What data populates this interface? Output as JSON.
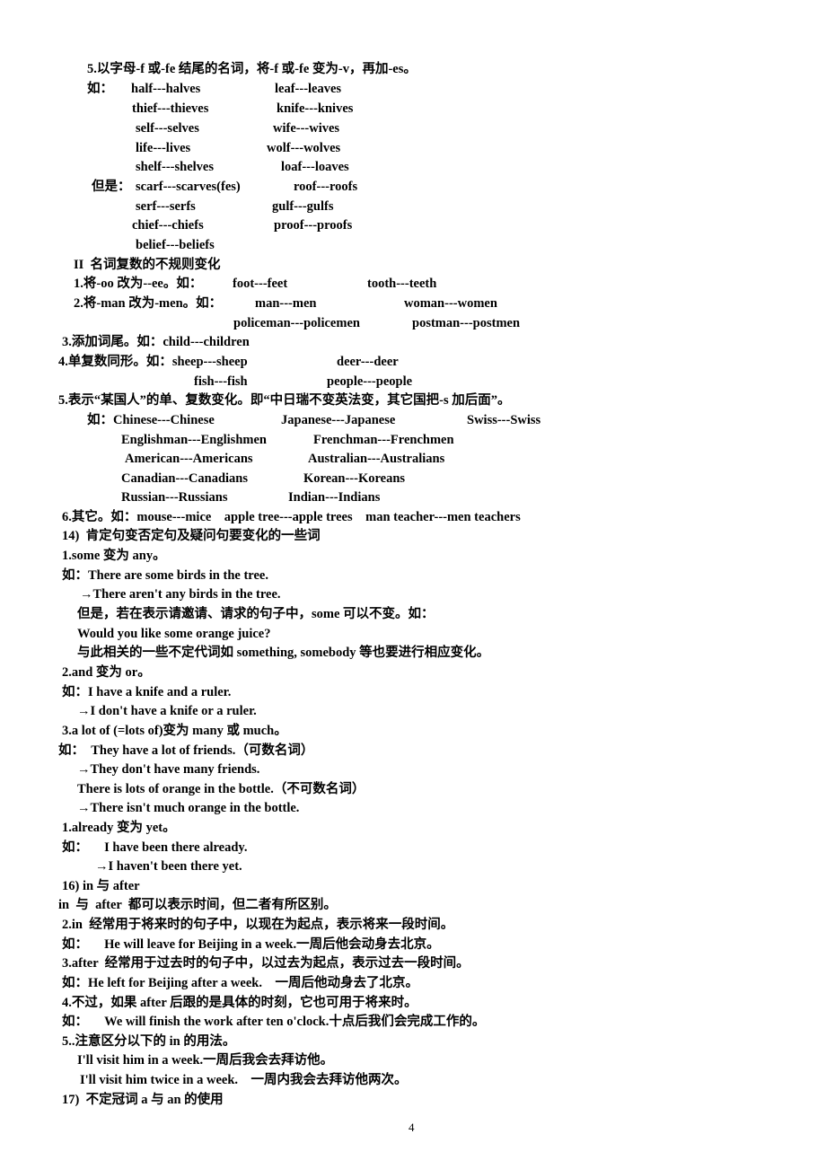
{
  "page_number": "4",
  "section_f_fe": {
    "heading": "5.以字母-f 或-fe 结尾的名词，将-f 或-fe 变为-v，再加-es。",
    "example_label": "如：",
    "exception_label": "但是：",
    "pairs": [
      [
        "half---halves",
        "leaf---leaves"
      ],
      [
        "thief---thieves",
        "knife---knives"
      ],
      [
        "self---selves",
        "wife---wives"
      ],
      [
        "life---lives",
        "wolf---wolves"
      ],
      [
        "shelf---shelves",
        "loaf---loaves"
      ]
    ],
    "exceptions": [
      [
        "scarf---scarves(fes)",
        "roof---roofs"
      ],
      [
        "serf---serfs",
        "gulf---gulfs"
      ],
      [
        "chief---chiefs",
        "proof---proofs"
      ],
      [
        "belief---beliefs",
        ""
      ]
    ]
  },
  "section_irregular": {
    "heading": "II  名词复数的不规则变化",
    "item1": {
      "label": "1.将-oo 改为--ee。如：",
      "a": "foot---feet",
      "b": "tooth---teeth"
    },
    "item2": {
      "label": "2.将-man 改为-men。如：",
      "a": "man---men",
      "b": "woman---women",
      "c": "policeman---policemen",
      "d": "postman---postmen"
    },
    "item3": {
      "label": "3.添加词尾。如：child---children"
    },
    "item4": {
      "label": "4.单复数同形。如：sheep---sheep",
      "b": "deer---deer",
      "c": "fish---fish",
      "d": "people---people"
    },
    "item5": {
      "label": "5.表示“某国人”的单、复数变化。即“中日瑞不变英法变，其它国把-s 加后面”。",
      "ex_label": "如：Chinese---Chinese",
      "r1b": "Japanese---Japanese",
      "r1c": "Swiss---Swiss",
      "rows": [
        [
          "Englishman---Englishmen",
          "Frenchman---Frenchmen"
        ],
        [
          "American---Americans",
          "Australian---Australians"
        ],
        [
          "Canadian---Canadians",
          "Korean---Koreans"
        ],
        [
          "Russian---Russians",
          "Indian---Indians"
        ]
      ]
    },
    "item6": "6.其它。如：mouse---mice    apple tree---apple trees    man teacher---men teachers"
  },
  "section14": {
    "heading": "14)  肯定句变否定句及疑问句要变化的一些词",
    "lines": [
      "1.some 变为 any。",
      "如：There are some birds in the tree.",
      "→There aren't any birds in the tree.",
      "但是，若在表示请邀请、请求的句子中，some 可以不变。如：",
      "Would you like some orange juice?",
      "与此相关的一些不定代词如 something, somebody 等也要进行相应变化。",
      "2.and 变为 or。",
      "如：I have a knife and a ruler.",
      "→I don't have a knife or a ruler.",
      "3.a lot of (=lots of)变为 many 或 much。",
      "如：  They have a lot of friends.（可数名词）",
      "→They don't have many friends.",
      "There is lots of orange in the bottle.（不可数名词）",
      "→There isn't much orange in the bottle.",
      "1.already 变为 yet。",
      "如：     I have been there already.",
      "→I haven't been there yet."
    ]
  },
  "section16": {
    "heading": "16) in 与 after",
    "lines": [
      "in  与  after  都可以表示时间，但二者有所区别。",
      "2.in  经常用于将来时的句子中，以现在为起点，表示将来一段时间。",
      "如：     He will leave for Beijing in a week.一周后他会动身去北京。",
      "3.after  经常用于过去时的句子中，以过去为起点，表示过去一段时间。",
      "如：He left for Beijing after a week.    一周后他动身去了北京。",
      "4.不过，如果 after 后跟的是具体的时刻，它也可用于将来时。",
      "如：     We will finish the work after ten o'clock.十点后我们会完成工作的。",
      "5..注意区分以下的 in 的用法。",
      "I'll visit him in a week.一周后我会去拜访他。",
      "I'll visit him twice in a week.    一周内我会去拜访他两次。"
    ]
  },
  "section17": {
    "heading": "17)  不定冠词 a 与 an 的使用"
  }
}
